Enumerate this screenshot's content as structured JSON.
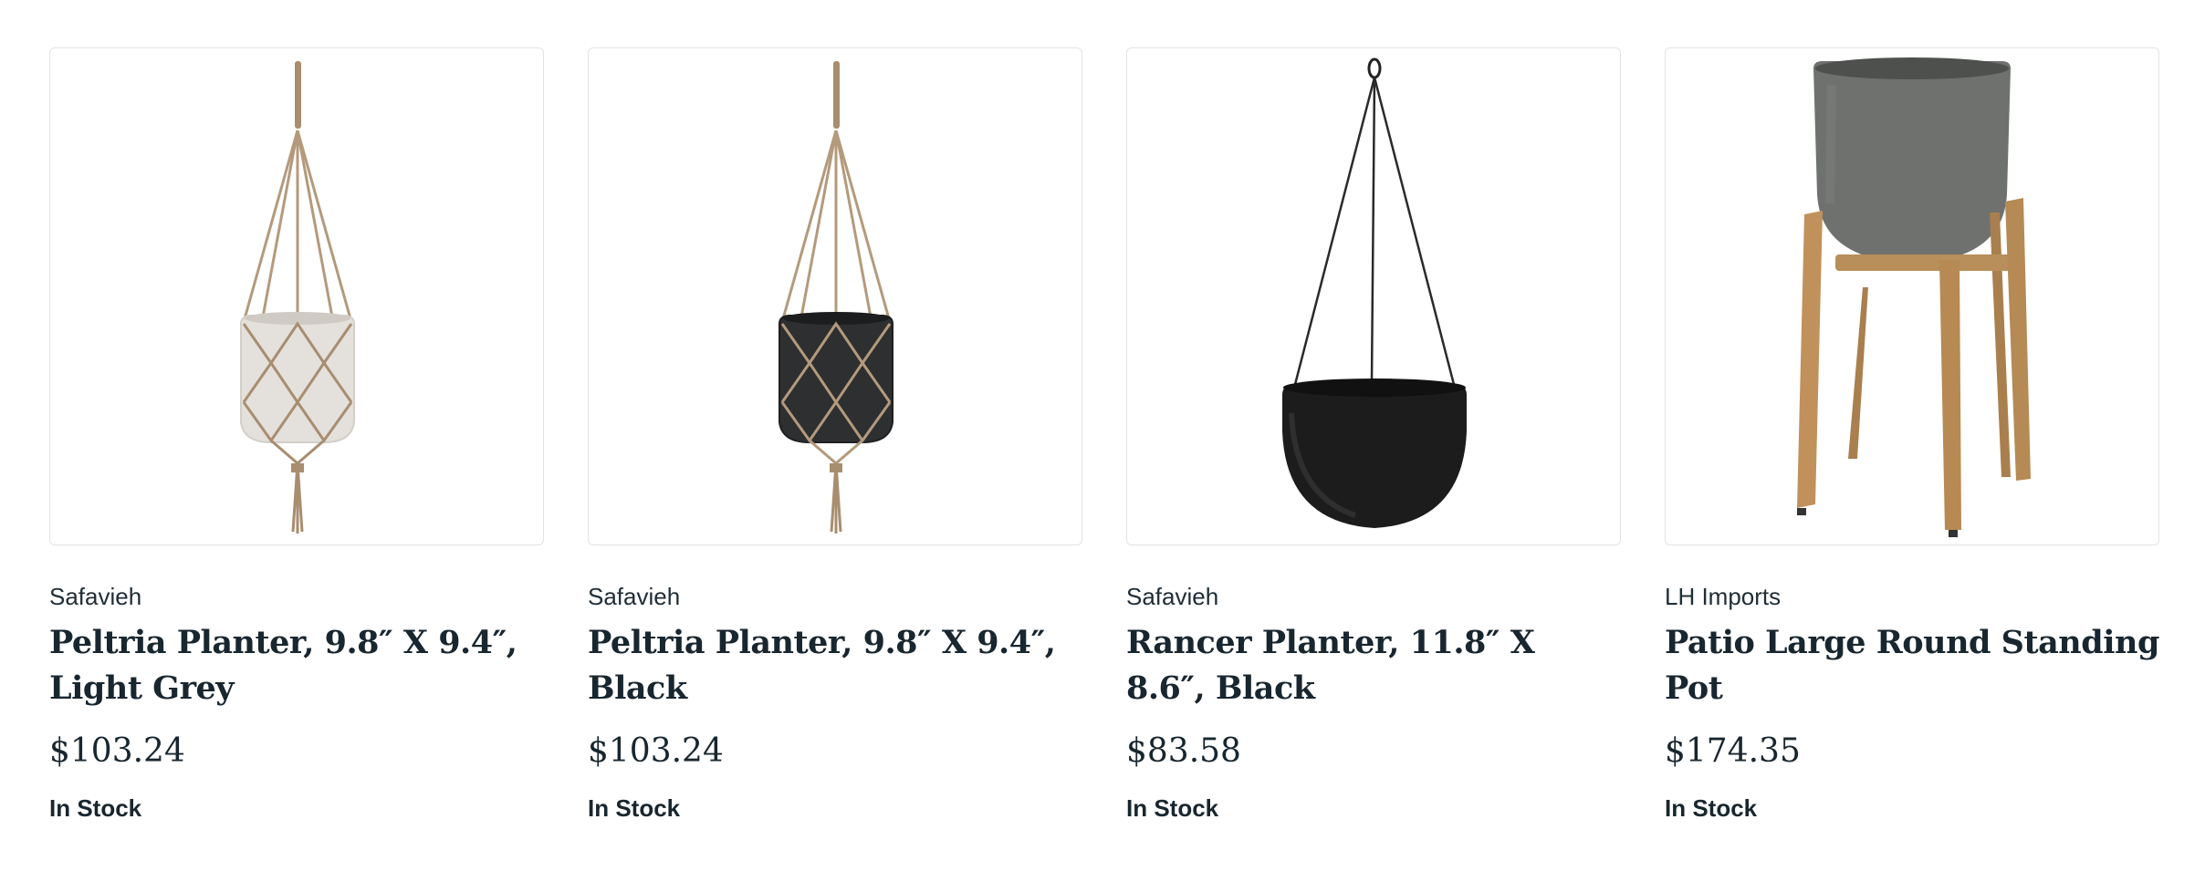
{
  "products": [
    {
      "brand": "Safavieh",
      "name": "Peltria Planter, 9.8″ X 9.4″, Light Grey",
      "price": "$103.24",
      "stock": "In Stock",
      "image": "light-grey-hanging-macrame-planter"
    },
    {
      "brand": "Safavieh",
      "name": "Peltria Planter, 9.8″ X 9.4″, Black",
      "price": "$103.24",
      "stock": "In Stock",
      "image": "black-hanging-macrame-planter"
    },
    {
      "brand": "Safavieh",
      "name": "Rancer Planter, 11.8″ X 8.6″, Black",
      "price": "$83.58",
      "stock": "In Stock",
      "image": "black-hanging-wire-planter"
    },
    {
      "brand": "LH Imports",
      "name": "Patio Large Round Standing Pot",
      "price": "$174.35",
      "stock": "In Stock",
      "image": "grey-pot-on-wooden-stand"
    }
  ],
  "colors": {
    "text": "#18262f",
    "border": "#e3e3e3",
    "macrame": "#b49a7c",
    "light_pot": "#e4e1dc",
    "dark_pot": "#2e2f31",
    "black_pot": "#1c1c1d",
    "stone_pot": "#6f716f",
    "wood": "#b58a55"
  }
}
